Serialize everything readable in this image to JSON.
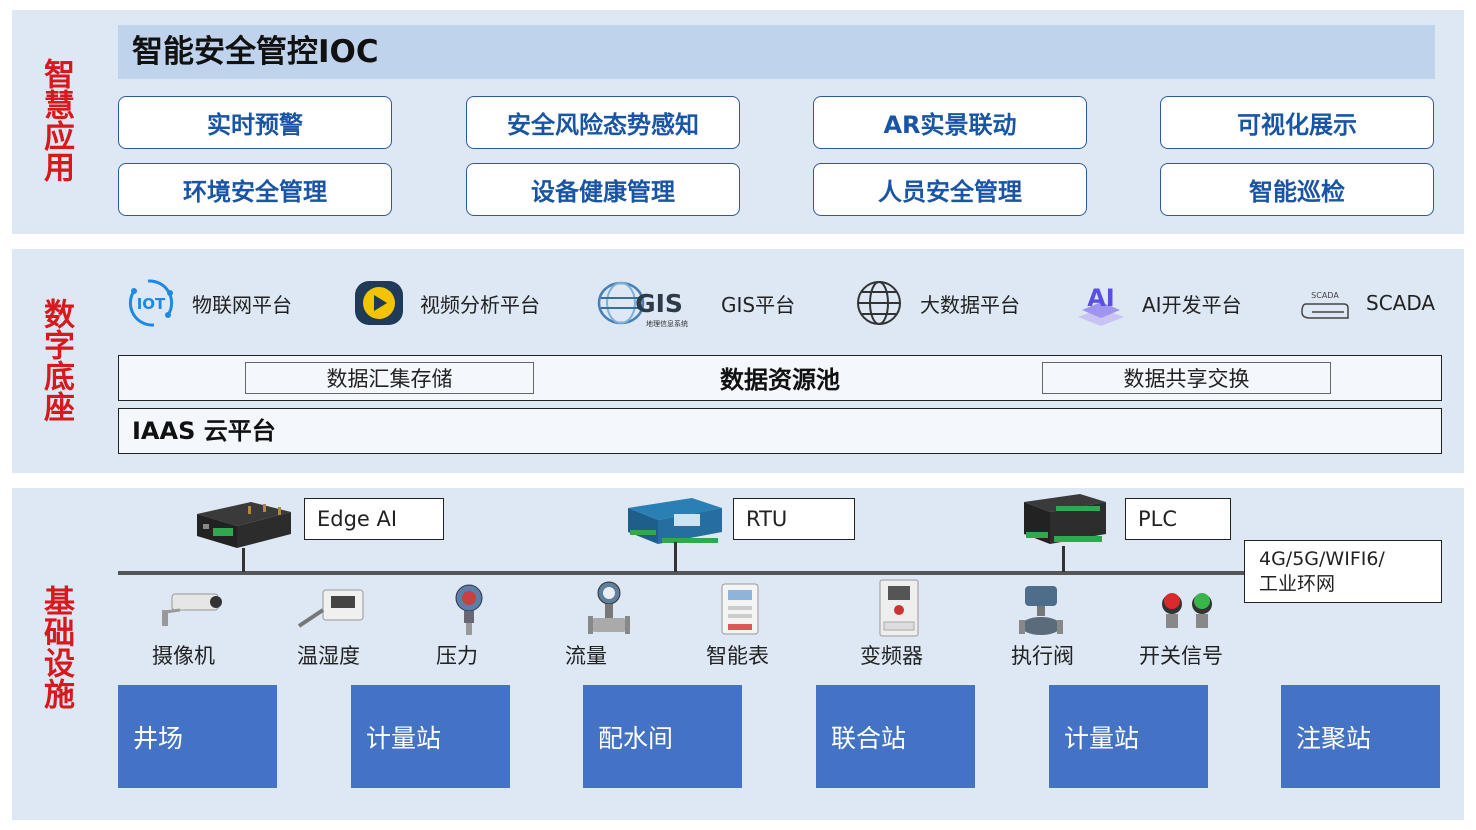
{
  "layers": {
    "application": "智慧应用",
    "digital": "数字底座",
    "infrastructure": "基础设施"
  },
  "ioc": {
    "title": "智能安全管控IOC"
  },
  "apps": [
    "实时预警",
    "安全风险态势感知",
    "AR实景联动",
    "可视化展示",
    "环境安全管理",
    "设备健康管理",
    "人员安全管理",
    "智能巡检"
  ],
  "platforms": [
    {
      "label": "物联网平台",
      "icon": "iot-icon",
      "icon_text": "IOT"
    },
    {
      "label": "视频分析平台",
      "icon": "video-play-icon"
    },
    {
      "label": "GIS平台",
      "icon": "gis-logo-icon",
      "icon_text": "GIS",
      "icon_subtext": "地理信息系统"
    },
    {
      "label": "大数据平台",
      "icon": "globe-icon"
    },
    {
      "label": "AI开发平台",
      "icon": "ai-icon",
      "icon_text": "AI"
    },
    {
      "label": "SCADA",
      "icon": "scada-icon",
      "icon_text": "SCADA"
    }
  ],
  "data_pool": {
    "title": "数据资源池",
    "left": "数据汇集存储",
    "right": "数据共享交换"
  },
  "iaas": "IAAS 云平台",
  "gateways": [
    {
      "label": "Edge AI",
      "icon": "edge-ai-device-icon"
    },
    {
      "label": "RTU",
      "icon": "rtu-device-icon"
    },
    {
      "label": "PLC",
      "icon": "plc-device-icon"
    }
  ],
  "network": "4G/5G/WIFI6/\n工业环网",
  "sensors": [
    {
      "label": "摄像机",
      "icon": "camera-icon"
    },
    {
      "label": "温湿度",
      "icon": "thermo-hygrometer-icon"
    },
    {
      "label": "压力",
      "icon": "pressure-transmitter-icon"
    },
    {
      "label": "流量",
      "icon": "flow-meter-icon"
    },
    {
      "label": "智能表",
      "icon": "smart-meter-icon"
    },
    {
      "label": "变频器",
      "icon": "inverter-icon"
    },
    {
      "label": "执行阀",
      "icon": "actuator-valve-icon"
    },
    {
      "label": "开关信号",
      "icon": "switch-button-icon"
    }
  ],
  "sites": [
    "井场",
    "计量站",
    "配水间",
    "联合站",
    "计量站",
    "注聚站"
  ],
  "colors": {
    "band": "#dde8f4",
    "layer_label": "#d9181d",
    "app_text": "#1a55a5",
    "site_fill": "#4472c4"
  }
}
